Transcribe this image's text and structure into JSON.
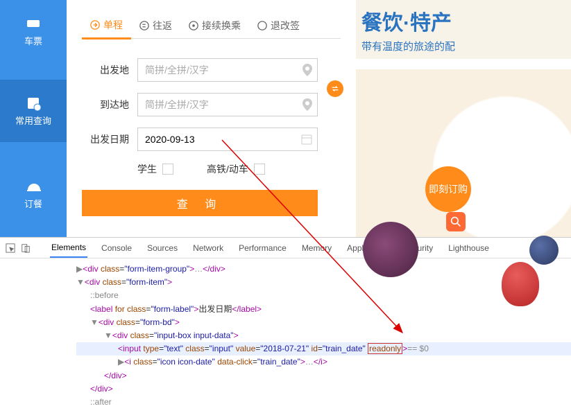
{
  "sidebar": {
    "items": [
      {
        "label": "车票"
      },
      {
        "label": "常用查询"
      },
      {
        "label": "订餐"
      }
    ]
  },
  "tabs": [
    {
      "label": "单程",
      "active": true
    },
    {
      "label": "往返",
      "active": false
    },
    {
      "label": "接续换乘",
      "active": false
    },
    {
      "label": "退改签",
      "active": false
    }
  ],
  "form": {
    "from_label": "出发地",
    "from_placeholder": "简拼/全拼/汉字",
    "to_label": "到达地",
    "to_placeholder": "简拼/全拼/汉字",
    "date_label": "出发日期",
    "date_value": "2020-09-13",
    "student_label": "学生",
    "gaotie_label": "高铁/动车",
    "submit_label": "查 询"
  },
  "banner": {
    "title": "餐饮·特产",
    "subtitle": "带有温度的旅途的配",
    "buy": "即刻订购"
  },
  "devtools": {
    "tabs": [
      "Elements",
      "Console",
      "Sources",
      "Network",
      "Performance",
      "Memory",
      "Application",
      "Security",
      "Lighthouse"
    ],
    "active": "Elements",
    "dom": {
      "l1_cls": "form-item-group",
      "l2_cls": "form-item",
      "before": "::before",
      "label_for_cls": "form-label",
      "label_text": "出发日期",
      "formbd_cls": "form-bd",
      "inputbox_cls": "input-box input-data",
      "input_type": "text",
      "input_cls": "input",
      "input_value": "2018-07-21",
      "input_id": "train_date",
      "input_readonly": "readonly",
      "input_suffix": "== $0",
      "i_cls": "icon icon-date",
      "i_dataclick": "train_date",
      "after": "::after"
    }
  }
}
